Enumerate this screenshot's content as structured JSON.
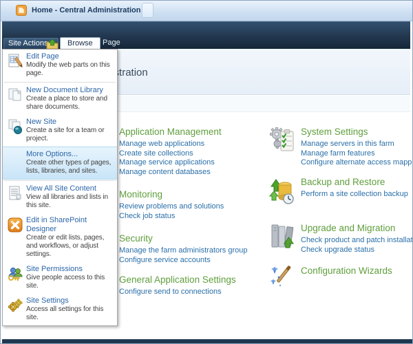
{
  "window": {
    "title": "Home - Central Administration"
  },
  "ribbon": {
    "site_actions_label": "Site Actions",
    "caret": "▾",
    "tabs": [
      {
        "label": "Browse",
        "active": true
      },
      {
        "label": "Page",
        "active": false
      }
    ]
  },
  "page": {
    "title": "Central Administration"
  },
  "site_actions_menu": {
    "items": [
      {
        "label": "Edit Page",
        "desc": "Modify the web parts on this page.",
        "icon": "edit-page-icon",
        "separator_after": true,
        "highlighted": false
      },
      {
        "label": "New Document Library",
        "desc": "Create a place to store and share documents.",
        "icon": "new-document-library-icon",
        "separator_after": false,
        "highlighted": false
      },
      {
        "label": "New Site",
        "desc": "Create a site for a team or project.",
        "icon": "new-site-icon",
        "separator_after": false,
        "highlighted": false
      },
      {
        "label": "More Options...",
        "desc": "Create other types of pages, lists, libraries, and sites.",
        "icon": "",
        "separator_after": true,
        "highlighted": true
      },
      {
        "label": "View All Site Content",
        "desc": "View all libraries and lists in this site.",
        "icon": "view-all-site-content-icon",
        "separator_after": false,
        "highlighted": false
      },
      {
        "label": "Edit in SharePoint Designer",
        "desc": "Create or edit lists, pages, and workflows, or adjust settings.",
        "icon": "sharepoint-designer-icon",
        "separator_after": false,
        "highlighted": false
      },
      {
        "label": "Site Permissions",
        "desc": "Give people access to this site.",
        "icon": "site-permissions-icon",
        "separator_after": false,
        "highlighted": false
      },
      {
        "label": "Site Settings",
        "desc": "Access all settings for this site.",
        "icon": "site-settings-icon",
        "separator_after": false,
        "highlighted": false
      }
    ]
  },
  "sections": {
    "left": [
      {
        "title": "Application Management",
        "icon": "application-management-icon",
        "links": [
          "Manage web applications",
          "Create site collections",
          "Manage service applications",
          "Manage content databases"
        ]
      },
      {
        "title": "Monitoring",
        "icon": "monitoring-icon",
        "links": [
          "Review problems and solutions",
          "Check job status"
        ]
      },
      {
        "title": "Security",
        "icon": "security-icon",
        "links": [
          "Manage the farm administrators group",
          "Configure service accounts"
        ]
      },
      {
        "title": "General Application Settings",
        "icon": "general-application-settings-icon",
        "links": [
          "Configure send to connections"
        ]
      }
    ],
    "right": [
      {
        "title": "System Settings",
        "icon": "system-settings-icon",
        "links": [
          "Manage servers in this farm",
          "Manage farm features",
          "Configure alternate access mappings"
        ]
      },
      {
        "title": "Backup and Restore",
        "icon": "backup-restore-icon",
        "links": [
          "Perform a site collection backup"
        ]
      },
      {
        "title": "Upgrade and Migration",
        "icon": "upgrade-migration-icon",
        "links": [
          "Check product and patch installation status",
          "Check upgrade status"
        ]
      },
      {
        "title": "Configuration Wizards",
        "icon": "configuration-wizards-icon",
        "links": []
      }
    ]
  },
  "colors": {
    "titlebar_bg": "#d8e6f7",
    "chrome_navy": "#22374e",
    "heading_green": "#5f9e3c",
    "link_blue": "#2a6fa8",
    "menu_title_blue": "#2c66a8",
    "menu_highlight": "#cfe7f8",
    "spd_orange": "#ef9c2c"
  }
}
